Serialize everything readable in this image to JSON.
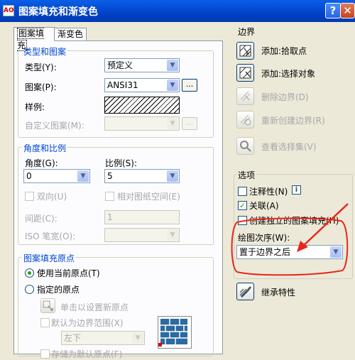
{
  "window": {
    "title": "图案填充和渐变色",
    "help_label": "?",
    "close_label": "✕",
    "icon_label": "AO"
  },
  "tabs": [
    {
      "label": "图案填充"
    },
    {
      "label": "渐变色"
    }
  ],
  "type_pattern": {
    "group_title": "类型和图案",
    "type_label": "类型(Y):",
    "type_value": "预定义",
    "pattern_label": "图案(P):",
    "pattern_value": "ANSI31",
    "browse_label": "...",
    "sample_label": "样例:",
    "custom_label": "自定义图案(M):",
    "custom_browse_label": "..."
  },
  "angle_scale": {
    "group_title": "角度和比例",
    "angle_label": "角度(G):",
    "angle_value": "0",
    "scale_label": "比例(S):",
    "scale_value": "5",
    "double_label": "双向(U)",
    "relative_label": "相对图纸空间(E)",
    "spacing_label": "间距(C):",
    "spacing_value": "1",
    "iso_label": "ISO 笔宽(O):"
  },
  "origin": {
    "group_title": "图案填充原点",
    "use_current_label": "使用当前原点(T)",
    "specified_label": "指定的原点",
    "click_set_label": "单击以设置新原点",
    "default_extent_label": "默认为边界范围(X)",
    "position_value": "左下",
    "store_default_label": "存储为默认原点(F)"
  },
  "boundary": {
    "group_title": "边界",
    "pick_points_label": "添加:拾取点",
    "select_objects_label": "添加:选择对象",
    "remove_label": "删除边界(D)",
    "recreate_label": "重新创建边界(R)",
    "view_selection_label": "查看选择集(V)"
  },
  "options": {
    "group_title": "选项",
    "annotative_label": "注释性(N)",
    "info_label": "i",
    "associative_label": "关联(A)",
    "separate_label": "创建独立的图案填充(H)",
    "draw_order_label": "绘图次序(W):",
    "draw_order_value": "置于边界之后"
  },
  "inherit": {
    "label": "继承特性"
  },
  "state": {
    "annotative": false,
    "associative": true,
    "separate": false,
    "use_current_origin": true
  },
  "colors": {
    "accent_title": "#0046d5",
    "annotation_red": "#e8261c"
  }
}
